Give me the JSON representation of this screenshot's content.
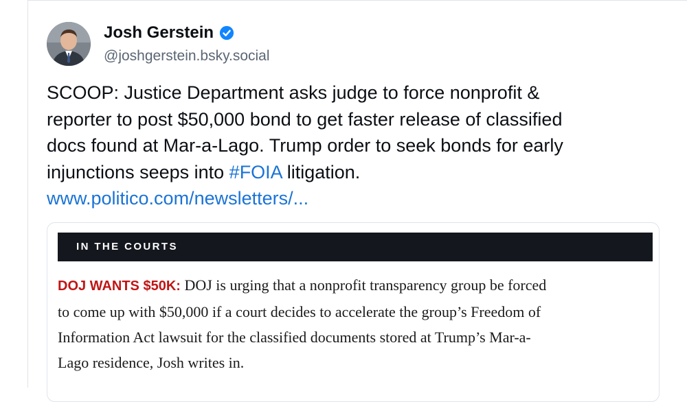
{
  "author": {
    "name": "Josh Gerstein",
    "handle": "@joshgerstein.bsky.social"
  },
  "post": {
    "line1": "SCOOP: Justice Department asks judge to force nonprofit &",
    "line2": "reporter to post $50,000 bond to get faster release of classified",
    "line3": "docs found at Mar-a-Lago. Trump order to seek bonds for early",
    "line4_before": "injunctions seeps into ",
    "hashtag": "#FOIA",
    "line4_after": " litigation.",
    "link": "www.politico.com/newsletters/..."
  },
  "embed": {
    "section": "IN THE COURTS",
    "kicker": "DOJ WANTS $50K:",
    "line1_rest": " DOJ is urging that a nonprofit transparency group be forced",
    "line2": "to come up with $50,000 if a court decides to accelerate the group’s Freedom of",
    "line3": "Information Act lawsuit for the classified documents stored at Trump’s Mar-a-",
    "line4": "Lago residence, Josh writes in."
  },
  "colors": {
    "link": "#1a73d6",
    "verified": "#1185fe",
    "kicker": "#c01515",
    "banner": "#15171e"
  },
  "icons": {
    "verified": "verified-badge-icon"
  }
}
